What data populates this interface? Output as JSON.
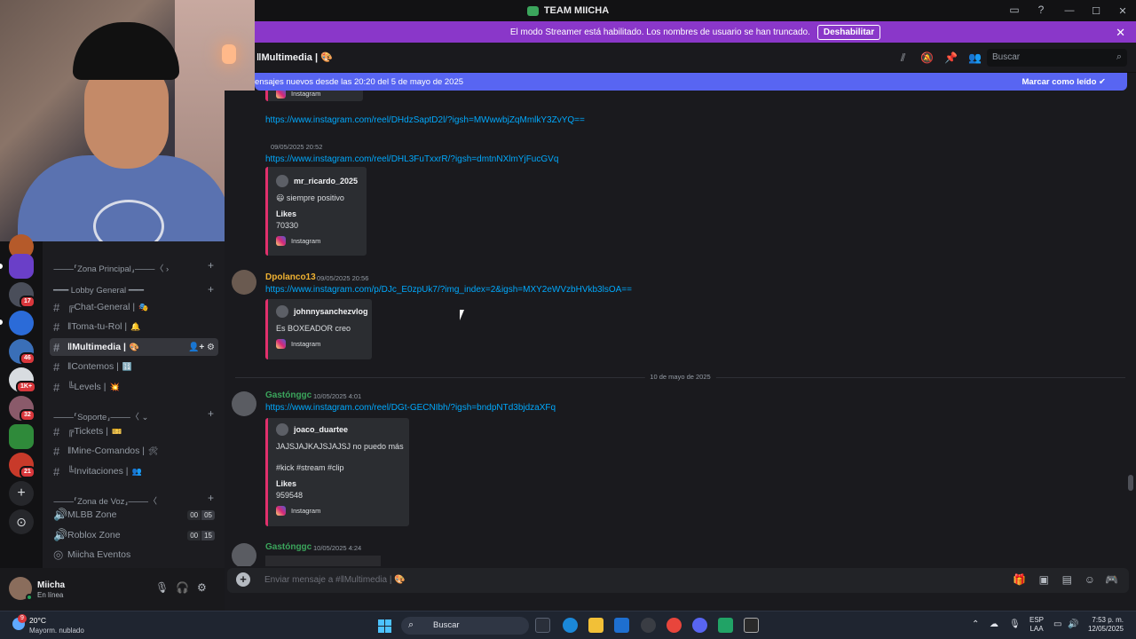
{
  "window": {
    "title": "TEAM MIICHA",
    "controls": [
      "—",
      "☐",
      "✕"
    ],
    "top_icons": [
      "inbox-icon",
      "help-icon"
    ]
  },
  "banner": {
    "text": "El modo Streamer está habilitado. Los nombres de usuario se han truncado.",
    "button": "Deshabilitar",
    "close": "✕"
  },
  "channel_header": {
    "name": "‖Multimedia |",
    "emoji": "🎨",
    "icons": [
      "threads-icon",
      "mute-icon",
      "pin-icon",
      "members-icon"
    ],
    "search_placeholder": "Buscar"
  },
  "new_messages": {
    "text": "ensajes nuevos desde las 20:20 del 5 de mayo de 2025",
    "action": "Marcar como leído"
  },
  "servers": {
    "badges": [
      "17",
      "46",
      "1K+",
      "32",
      "21"
    ],
    "add": "+",
    "explore": "⊙"
  },
  "sidebar": {
    "categories": [
      {
        "label": "⸻⸢Zona Principal⸥⸻〈 ›"
      },
      {
        "label": "━━━ Lobby General ━━━"
      },
      {
        "label": "⸻⸢Soporte⸥⸻〈 ⌄"
      },
      {
        "label": "⸻⸢Zona de Voz⸥⸻〈"
      }
    ],
    "channels": [
      {
        "label": "╔Chat-General |",
        "emoji": "🎭"
      },
      {
        "label": "‖Toma-tu-Rol |",
        "emoji": "🔔"
      },
      {
        "label": "‖Multimedia |",
        "emoji": "🎨",
        "tools": "👤+ ⚙"
      },
      {
        "label": "‖Contemos |",
        "emoji": "🔢"
      },
      {
        "label": "╚Levels |",
        "emoji": "💥"
      },
      {
        "label": "╔Tickets |",
        "emoji": "🎫"
      },
      {
        "label": "‖Mine-Comandos |",
        "emoji": "🛠"
      },
      {
        "label": "╚Invitaciones |",
        "emoji": "👥"
      }
    ],
    "voice": [
      {
        "label": "MLBB Zone",
        "a": "00",
        "b": "05"
      },
      {
        "label": "Roblox Zone",
        "a": "00",
        "b": "15"
      },
      {
        "label": "Miicha Eventos"
      }
    ]
  },
  "user": {
    "name": "Miicha",
    "status": "En línea"
  },
  "messages": {
    "m0": {
      "link": "https://www.instagram.com/reel/DHdzSaptD2l/?igsh=MWwwbjZqMmlkY3ZvYQ==",
      "embed_foot": "Instagram"
    },
    "m1": {
      "ts": "09/05/2025 20:52",
      "link": "https://www.instagram.com/reel/DHL3FuTxxrR/?igsh=dmtnNXlmYjFucGVq",
      "embed": {
        "user": "mr_ricardo_2025",
        "text": "😃 siempre positivo",
        "likes_label": "Likes",
        "likes": "70330",
        "foot": "Instagram"
      }
    },
    "m2": {
      "author": "Dpolanco13",
      "ts": "09/05/2025 20:56",
      "link": "https://www.instagram.com/p/DJc_E0zpUk7/?img_index=2&igsh=MXY2eWVzbHVkb3lsOA==",
      "embed": {
        "user": "johnnysanchezvlog",
        "text": "Es BOXEADOR creo",
        "foot": "Instagram"
      }
    },
    "divider": "10 de mayo de 2025",
    "m3": {
      "author": "Gastónggc",
      "ts": "10/05/2025 4:01",
      "link": "https://www.instagram.com/reel/DGt-GECNIbh/?igsh=bndpNTd3bjdzaXFq",
      "embed": {
        "user": "joaco_duartee",
        "text": "JAJSJAJKAJSJAJSJ no puedo más",
        "tags": "#kick #stream #clip",
        "likes_label": "Likes",
        "likes": "959548",
        "foot": "Instagram"
      }
    },
    "m4": {
      "author": "Gastónggc",
      "ts": "10/05/2025 4:24"
    }
  },
  "composer": {
    "placeholder": "Enviar mensaje a #‖Multimedia |",
    "emoji": "🎨",
    "icons": [
      "gift-icon",
      "gif-icon",
      "sticker-icon",
      "emoji-icon",
      "apps-icon"
    ]
  },
  "taskbar": {
    "weather_temp": "20°C",
    "weather_desc": "Mayorm. nublado",
    "weather_badge": "9",
    "search": "Buscar",
    "lang1": "ESP",
    "lang2": "LAA",
    "time": "7:53 p. m.",
    "date": "12/05/2025"
  },
  "colors": {
    "banner": "#8a37c9",
    "new_messages": "#5865f2",
    "link": "#00a8fc",
    "author_gold": "#f0b232",
    "author_green": "#3ba55c",
    "embed_border": "#e1306c"
  }
}
